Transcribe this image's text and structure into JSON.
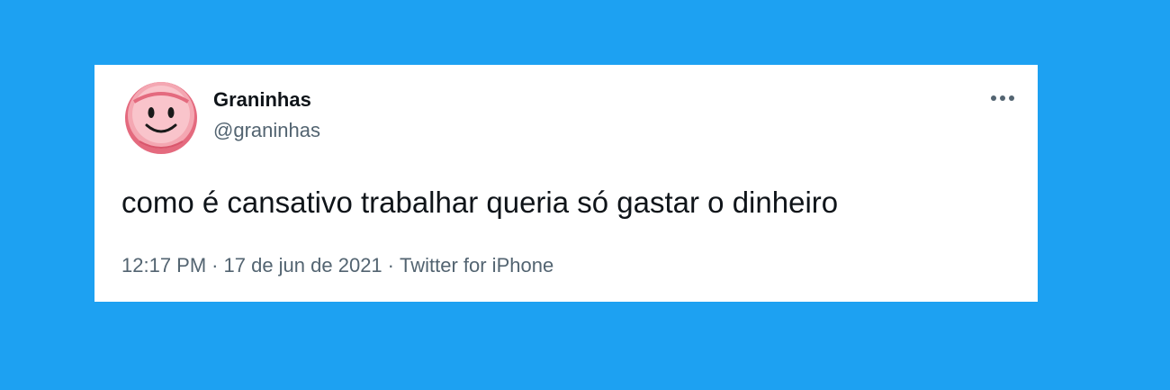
{
  "tweet": {
    "author": {
      "display_name": "Graninhas",
      "handle": "@graninhas",
      "avatar_icon": "smiley-coin-avatar"
    },
    "more_icon": "more-horizontal-icon",
    "text": "como é cansativo trabalhar queria só gastar o dinheiro",
    "time": "12:17 PM",
    "date": "17 de jun de 2021",
    "source": "Twitter for iPhone",
    "separator": "·"
  },
  "colors": {
    "background": "#1da1f2",
    "card": "#ffffff",
    "text_primary": "#0f1419",
    "text_secondary": "#536471",
    "avatar_pink": "#f7b6bd",
    "avatar_rim": "#e45b71"
  }
}
